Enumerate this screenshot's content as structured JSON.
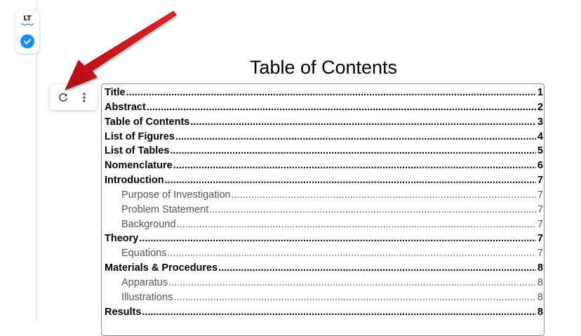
{
  "widget": {
    "logo_text": "LT",
    "check_icon": "checkmark-circle-icon",
    "accent": "#1a8cff"
  },
  "toolbar": {
    "refresh_icon": "refresh-icon",
    "more_icon": "more-vertical-icon"
  },
  "toc": {
    "title": "Table of Contents",
    "entries": [
      {
        "label": "Title",
        "page": "1",
        "level": 1
      },
      {
        "label": "Abstract",
        "page": "2",
        "level": 1
      },
      {
        "label": "Table of Contents",
        "page": "3",
        "level": 1
      },
      {
        "label": "List of Figures",
        "page": "4",
        "level": 1
      },
      {
        "label": "List of Tables",
        "page": "5",
        "level": 1
      },
      {
        "label": "Nomenclature",
        "page": "6",
        "level": 1
      },
      {
        "label": "Introduction",
        "page": "7",
        "level": 1
      },
      {
        "label": "Purpose of Investigation",
        "page": "7",
        "level": 2
      },
      {
        "label": "Problem Statement",
        "page": "7",
        "level": 2
      },
      {
        "label": "Background",
        "page": "7",
        "level": 2
      },
      {
        "label": "Theory",
        "page": "7",
        "level": 1
      },
      {
        "label": "Equations",
        "page": "7",
        "level": 2
      },
      {
        "label": "Materials & Procedures",
        "page": "8",
        "level": 1
      },
      {
        "label": "Apparatus",
        "page": "8",
        "level": 2
      },
      {
        "label": "Illustrations",
        "page": "8",
        "level": 2
      },
      {
        "label": "Results",
        "page": "8",
        "level": 1
      }
    ]
  },
  "annotation": {
    "arrow_color": "#d4141c"
  }
}
